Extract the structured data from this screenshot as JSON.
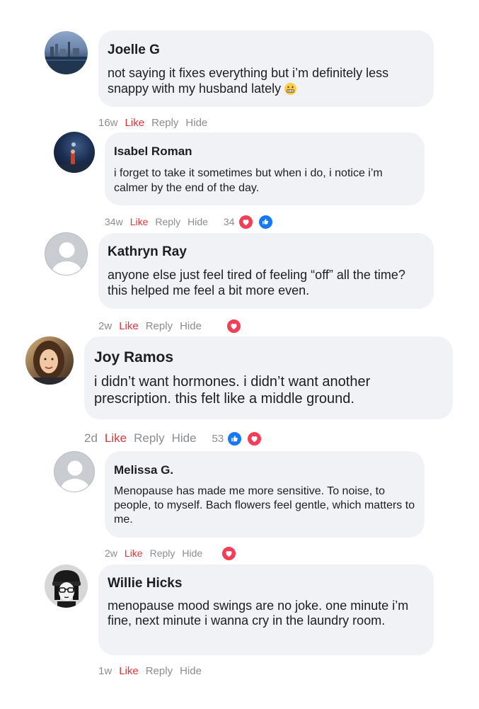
{
  "comments": [
    {
      "name": "Joelle G",
      "text": "not saying it fixes everything but i’m definitely less snappy with my husband lately",
      "emoji": "😬",
      "time": "16w",
      "like": "Like",
      "reply": "Reply",
      "hide": "Hide",
      "reaction_count": "",
      "avatar": "photo-harbor"
    },
    {
      "name": "Isabel Roman",
      "text": "i forget to take it sometimes but when i do, i notice i’m calmer by the end of the day.",
      "time": "34w",
      "like": "Like",
      "reply": "Reply",
      "hide": "Hide",
      "reaction_count": "34",
      "reactions": [
        "heart",
        "thumb"
      ],
      "avatar": "photo-night"
    },
    {
      "name": "Kathryn Ray",
      "text": "anyone else just feel tired of feeling “off” all the time? this helped me feel a bit more even.",
      "time": "2w",
      "like": "Like",
      "reply": "Reply",
      "hide": "Hide",
      "reaction_count": "",
      "reactions": [
        "heart"
      ],
      "avatar": "default-avatar"
    },
    {
      "name": "Joy Ramos",
      "text": "i didn’t want hormones. i didn’t want another prescription. this felt like a middle ground.",
      "time": "2d",
      "like": "Like",
      "reply": "Reply",
      "hide": "Hide",
      "reaction_count": "53",
      "reactions": [
        "thumb",
        "heart"
      ],
      "avatar": "photo-woman"
    },
    {
      "name": "Melissa G.",
      "text": "Menopause has made me more sensitive. To noise, to people, to myself. Bach flowers feel gentle, which matters to me.",
      "time": "2w",
      "like": "Like",
      "reply": "Reply",
      "hide": "Hide",
      "reaction_count": "",
      "reactions": [
        "heart"
      ],
      "avatar": "default-avatar"
    },
    {
      "name": "Willie Hicks",
      "text": "menopause mood swings are no joke. one minute i’m fine, next minute i wanna cry in the laundry room.",
      "time": "1w",
      "like": "Like",
      "reply": "Reply",
      "hide": "Hide",
      "reaction_count": "",
      "avatar": "illustration-beanie"
    }
  ],
  "colors": {
    "bubble": "#f0f2f5",
    "like": "#d7363b",
    "meta": "#8a8d91",
    "heart": "#f33e58",
    "thumb": "#1877f2"
  }
}
